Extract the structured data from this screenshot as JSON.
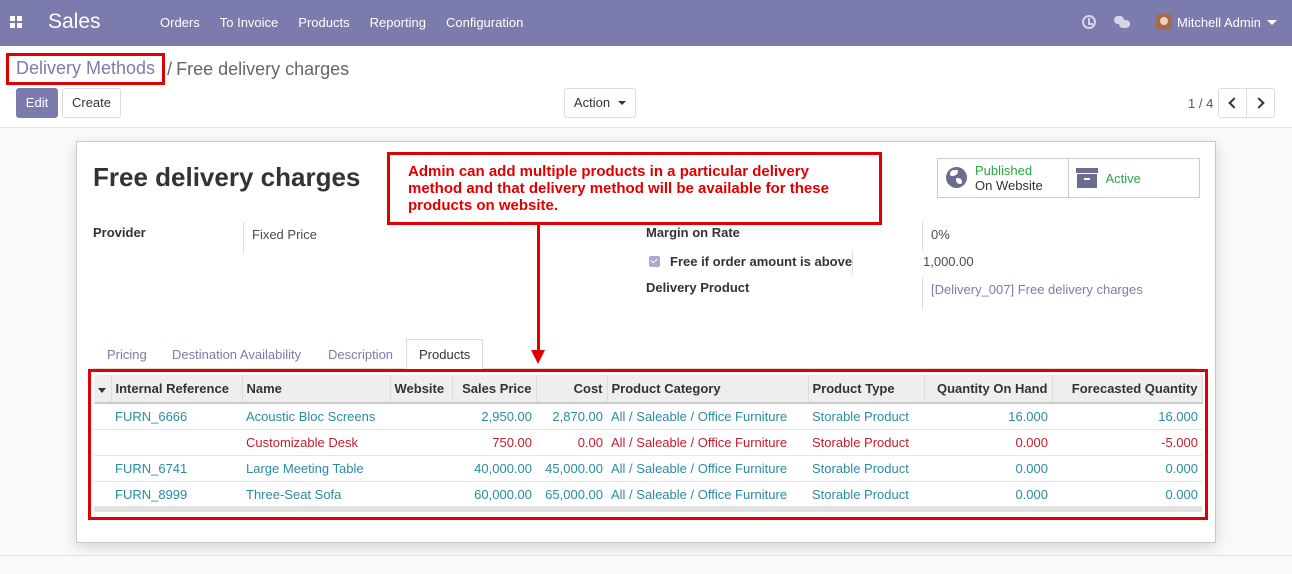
{
  "navbar": {
    "app_name": "Sales",
    "menu": [
      "Orders",
      "To Invoice",
      "Products",
      "Reporting",
      "Configuration"
    ],
    "user_name": "Mitchell Admin"
  },
  "breadcrumb": {
    "parent": "Delivery Methods",
    "separator": "/",
    "current": "Free delivery charges"
  },
  "buttons": {
    "edit": "Edit",
    "create": "Create",
    "action": "Action"
  },
  "pager": {
    "text": "1 / 4"
  },
  "record": {
    "title": "Free delivery charges",
    "smart_published_top": "Published",
    "smart_published_bottom": "On Website",
    "smart_active": "Active",
    "provider_label": "Provider",
    "provider_value": "Fixed Price",
    "margin_label": "Margin on Rate",
    "margin_value": "0%",
    "free_label": "Free if order amount is above",
    "free_value": "1,000.00",
    "delivery_product_label": "Delivery Product",
    "delivery_product_value": "[Delivery_007] Free delivery charges"
  },
  "annotation": {
    "text": "Admin can add multiple products in a particular delivery method and that delivery method will be available for these products on website."
  },
  "tabs": [
    "Pricing",
    "Destination Availability",
    "Description",
    "Products"
  ],
  "active_tab": "Products",
  "table": {
    "headers": [
      "Internal Reference",
      "Name",
      "Website",
      "Sales Price",
      "Cost",
      "Product Category",
      "Product Type",
      "Quantity On Hand",
      "Forecasted Quantity"
    ],
    "rows": [
      {
        "ref": "FURN_6666",
        "name": "Acoustic Bloc Screens",
        "website": "",
        "price": "2,950.00",
        "cost": "2,870.00",
        "category": "All / Saleable / Office Furniture",
        "type": "Storable Product",
        "qty": "16.000",
        "forecast": "16.000"
      },
      {
        "ref": "",
        "name": "Customizable Desk",
        "website": "",
        "price": "750.00",
        "cost": "0.00",
        "category": "All / Saleable / Office Furniture",
        "type": "Storable Product",
        "qty": "0.000",
        "forecast": "-5.000"
      },
      {
        "ref": "FURN_6741",
        "name": "Large Meeting Table",
        "website": "",
        "price": "40,000.00",
        "cost": "45,000.00",
        "category": "All / Saleable / Office Furniture",
        "type": "Storable Product",
        "qty": "0.000",
        "forecast": "0.000"
      },
      {
        "ref": "FURN_8999",
        "name": "Three-Seat Sofa",
        "website": "",
        "price": "60,000.00",
        "cost": "65,000.00",
        "category": "All / Saleable / Office Furniture",
        "type": "Storable Product",
        "qty": "0.000",
        "forecast": "0.000"
      }
    ]
  },
  "colors": {
    "navbar": "#7c7bad",
    "annotation_red": "#e00000",
    "row_text": "#2a8ca0",
    "row_danger": "#c41c2c",
    "published_green": "#28a745"
  },
  "icons": [
    "apps-grid-icon",
    "clock-icon",
    "chat-icon",
    "avatar",
    "chevron-left-icon",
    "chevron-right-icon",
    "globe-icon",
    "archive-icon",
    "checkbox-checked-icon",
    "sort-caret-icon"
  ]
}
